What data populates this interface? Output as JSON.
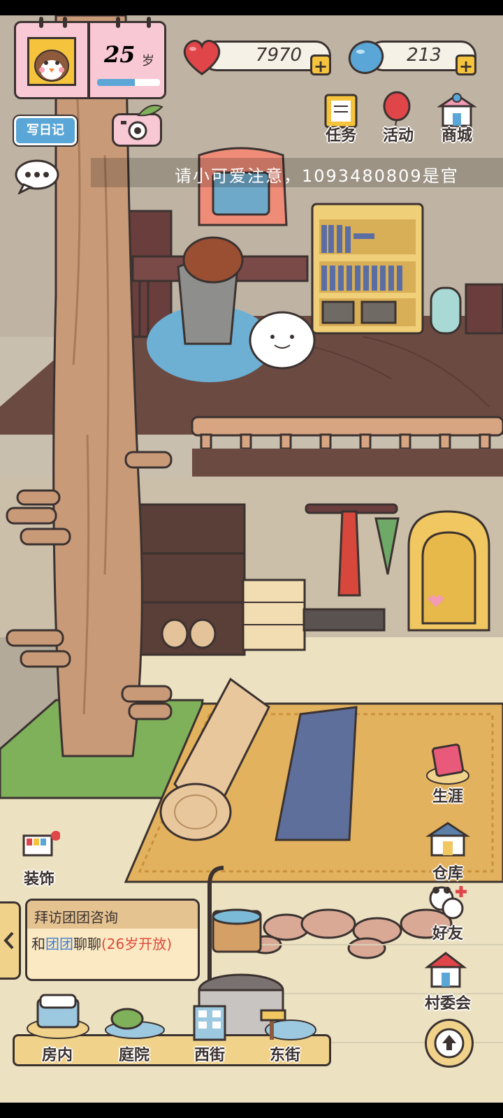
{
  "profile": {
    "age_value": "25",
    "age_unit": "岁",
    "age_progress": 0.6
  },
  "resources": {
    "hearts": {
      "value": "7970",
      "icon": "heart-icon",
      "color": "#e0454a"
    },
    "clovers": {
      "value": "213",
      "icon": "clover-token-icon",
      "color": "#5aa6d6"
    }
  },
  "top_buttons": {
    "diary": "写日记",
    "camera_icon": "camera-icon"
  },
  "top_right": {
    "task": "任务",
    "event": "活动",
    "shop": "商城"
  },
  "announcement": "请小可爱注意，1093480809是官",
  "side_menu": {
    "career": "生涯",
    "warehouse": "仓库",
    "friends": "好友",
    "village": "村委会"
  },
  "decorate": "装饰",
  "quest": {
    "title": "拜访团团咨询",
    "line_prefix": "和",
    "npc_name": "团团",
    "line_mid": "聊聊",
    "requirement": "(26岁开放)"
  },
  "bottom_nav": {
    "room": "房内",
    "yard": "庭院",
    "west": "西街",
    "east": "东街"
  },
  "colors": {
    "accent": "#f6c43c",
    "pink": "#f8c8d4",
    "blue": "#5aa6d6",
    "npc_name": "#3f7fd0",
    "requirement": "#e04a3a"
  }
}
